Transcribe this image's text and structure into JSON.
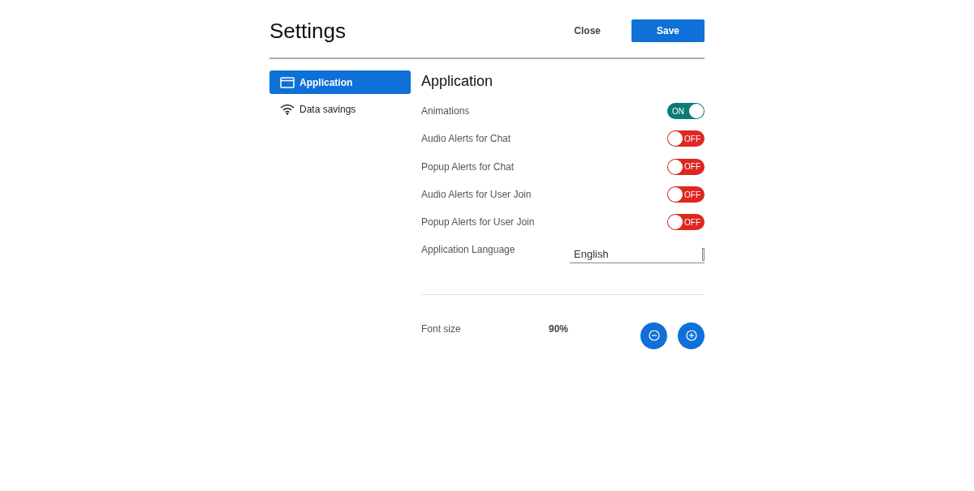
{
  "header": {
    "title": "Settings",
    "close": "Close",
    "save": "Save"
  },
  "sidebar": {
    "items": [
      {
        "label": "Application",
        "kind": "window",
        "selected": true
      },
      {
        "label": "Data savings",
        "kind": "wifi",
        "selected": false
      }
    ]
  },
  "section": {
    "title": "Application",
    "toggles": [
      {
        "label": "Animations",
        "on": true,
        "state_text": "ON"
      },
      {
        "label": "Audio Alerts for Chat",
        "on": false,
        "state_text": "OFF"
      },
      {
        "label": "Popup Alerts for Chat",
        "on": false,
        "state_text": "OFF"
      },
      {
        "label": "Audio Alerts for User Join",
        "on": false,
        "state_text": "OFF"
      },
      {
        "label": "Popup Alerts for User Join",
        "on": false,
        "state_text": "OFF"
      }
    ],
    "language": {
      "label": "Application Language",
      "value": "English"
    },
    "font_size": {
      "label": "Font size",
      "value": "90%"
    }
  }
}
